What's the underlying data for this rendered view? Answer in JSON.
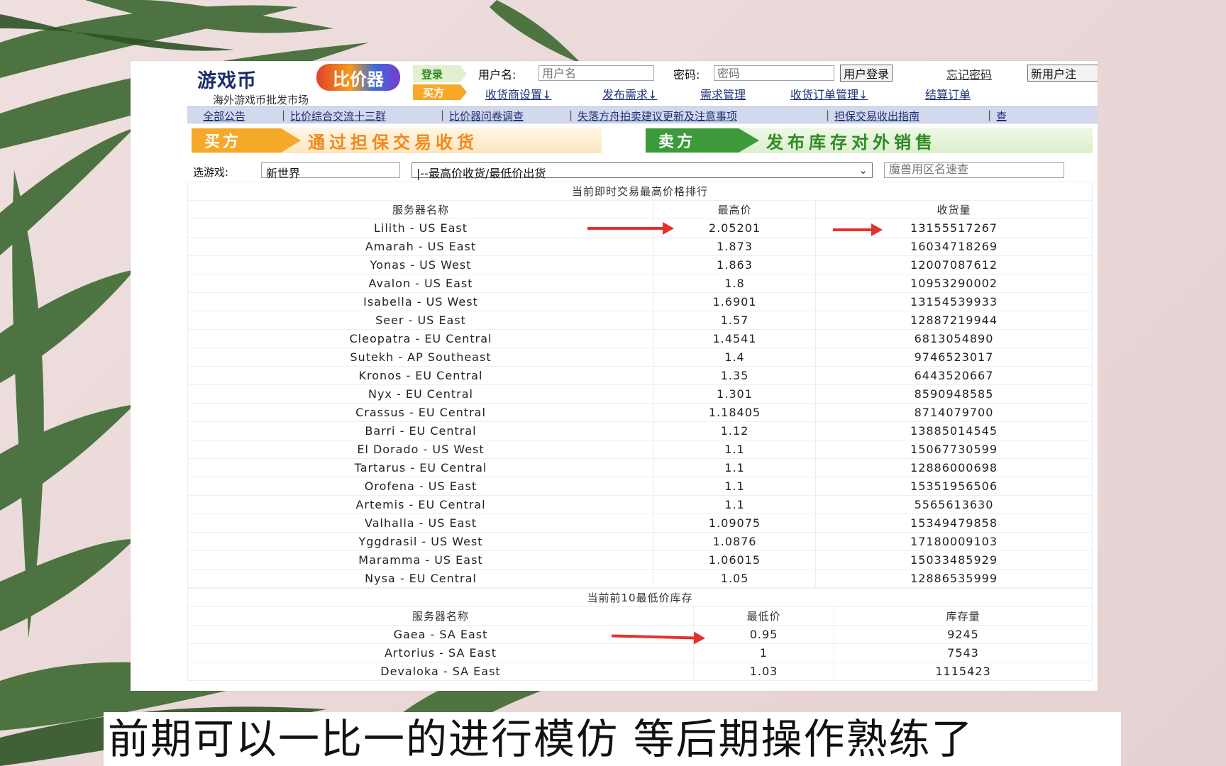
{
  "brand": {
    "logo_main": "游戏币",
    "logo_badge": "比价器",
    "tagline": "海外游戏币批发市场"
  },
  "login": {
    "login_badge": "登录",
    "username_label": "用户名:",
    "username_placeholder": "用户名",
    "password_label": "密码:",
    "password_placeholder": "密码",
    "login_button": "用户登录",
    "forgot_link": "忘记密码",
    "register_button": "新用户注"
  },
  "nav": {
    "buyer_badge": "买方",
    "links": [
      "收货商设置↓",
      "发布需求↓",
      "需求管理",
      "收货订单管理↓",
      "结算订单"
    ]
  },
  "announcements": [
    "全部公告",
    "比价综合交流十三群",
    "比价器问卷调查",
    "失落方舟拍卖建议更新及注意事项",
    "担保交易收出指南",
    "查"
  ],
  "banners": {
    "buy_tag": "买方",
    "buy_text": "通过担保交易收货",
    "sell_tag": "卖方",
    "sell_text": "发布库存对外销售"
  },
  "filters": {
    "game_label": "选游戏:",
    "game_value": "新世界",
    "sort_value": "|--最高价收货/最低价出货",
    "quick_search_placeholder": "魔兽用区名速查"
  },
  "high_table": {
    "title": "当前即时交易最高价格排行",
    "headers": [
      "服务器名称",
      "最高价",
      "收货量"
    ],
    "rows": [
      [
        "Lilith - US East",
        "2.05201",
        "13155517267"
      ],
      [
        "Amarah - US East",
        "1.873",
        "16034718269"
      ],
      [
        "Yonas - US West",
        "1.863",
        "12007087612"
      ],
      [
        "Avalon - US East",
        "1.8",
        "10953290002"
      ],
      [
        "Isabella - US West",
        "1.6901",
        "13154539933"
      ],
      [
        "Seer - US East",
        "1.57",
        "12887219944"
      ],
      [
        "Cleopatra - EU Central",
        "1.4541",
        "6813054890"
      ],
      [
        "Sutekh - AP Southeast",
        "1.4",
        "9746523017"
      ],
      [
        "Kronos - EU Central",
        "1.35",
        "6443520667"
      ],
      [
        "Nyx - EU Central",
        "1.301",
        "8590948585"
      ],
      [
        "Crassus - EU Central",
        "1.18405",
        "8714079700"
      ],
      [
        "Barri - EU Central",
        "1.12",
        "13885014545"
      ],
      [
        "El Dorado - US West",
        "1.1",
        "15067730599"
      ],
      [
        "Tartarus - EU Central",
        "1.1",
        "12886000698"
      ],
      [
        "Orofena - US East",
        "1.1",
        "15351956506"
      ],
      [
        "Artemis - EU Central",
        "1.1",
        "5565613630"
      ],
      [
        "Valhalla - US East",
        "1.09075",
        "15349479858"
      ],
      [
        "Yggdrasil - US West",
        "1.0876",
        "17180009103"
      ],
      [
        "Maramma - US East",
        "1.06015",
        "15033485929"
      ],
      [
        "Nysa - EU Central",
        "1.05",
        "12886535999"
      ]
    ]
  },
  "low_table": {
    "title": "当前前10最低价库存",
    "headers": [
      "服务器名称",
      "最低价",
      "库存量"
    ],
    "rows": [
      [
        "Gaea - SA East",
        "0.95",
        "9245"
      ],
      [
        "Artorius - SA East",
        "1",
        "7543"
      ],
      [
        "Devaloka - SA East",
        "1.03",
        "1115423"
      ]
    ]
  },
  "caption": "前期可以一比一的进行模仿  等后期操作熟练了",
  "colors": {
    "nav_text": "#1c2f78",
    "buy_orange": "#f6a829",
    "sell_green": "#3c9a3a",
    "arrow_red": "#e5312c",
    "banner_text_orange": "#f08a1c",
    "banner_text_green": "#2e8b23"
  }
}
